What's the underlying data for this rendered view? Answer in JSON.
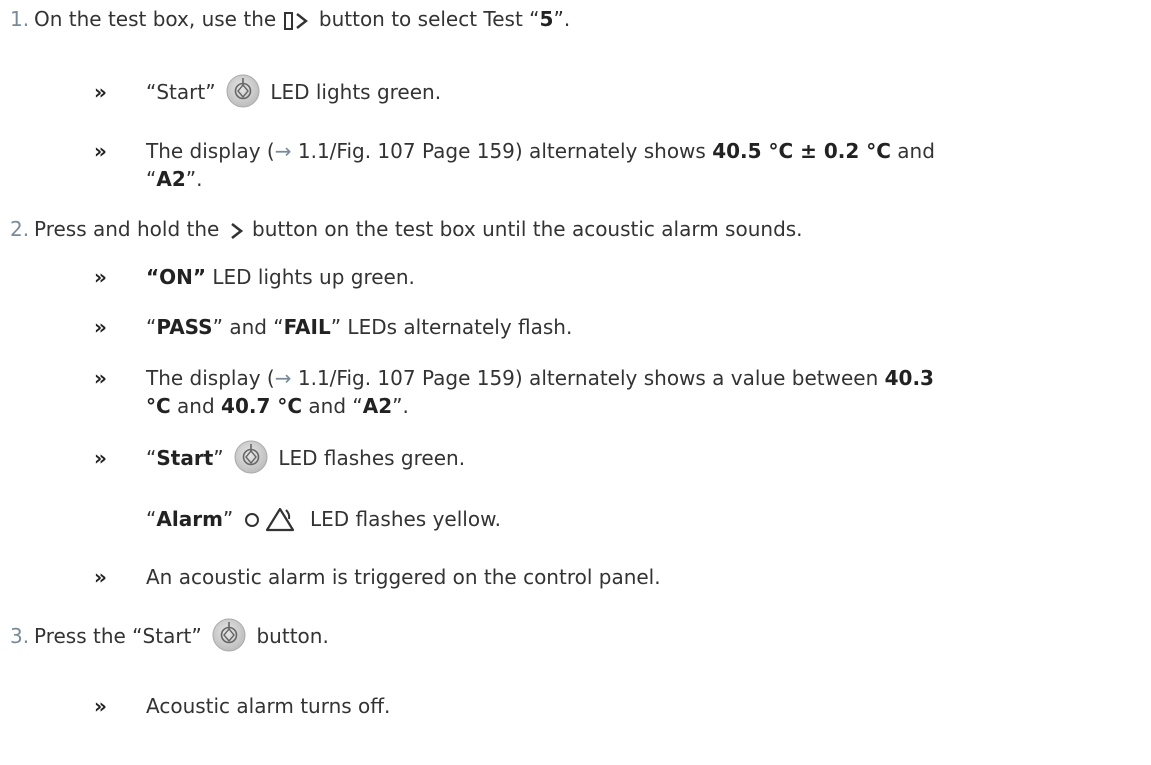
{
  "steps": [
    {
      "number": "1.",
      "text_a": "On the test box, use the",
      "text_b": "button to select Test “",
      "value": "5",
      "text_c": "”.",
      "icon": "bracket-next-icon",
      "results": [
        {
          "pre": "“Start”",
          "post": "LED lights green.",
          "icon": "start-button-icon"
        },
        {
          "line1_pre": "The display (",
          "arrow": "→",
          "ref": " 1.1/Fig. 107 Page 159) alternately shows ",
          "temp": "40.5 °C ± 0.2 °C",
          "and": " and",
          "line2_q1": "“",
          "code": "A2",
          "line2_q2": "”."
        }
      ]
    },
    {
      "number": "2.",
      "text_a": "Press and hold the",
      "text_b": "button on the test box until the acoustic alarm sounds.",
      "icon": "chevron-right-icon",
      "results": [
        {
          "on": "“ON”",
          "text": " LED lights up green."
        },
        {
          "q1": "“",
          "pass": "PASS",
          "mid": "” and “",
          "fail": "FAIL",
          "post": "” LEDs alternately flash."
        },
        {
          "line1_pre": "The display (",
          "arrow": "→",
          "ref": " 1.1/Fig. 107 Page 159) alternately shows a value between ",
          "val1": "40.3",
          "line2_unit": "°C",
          "line2_and": " and ",
          "val2": "40.7 °C",
          "line2_and2": " and “",
          "code": "A2",
          "line2_end": "”."
        },
        {
          "q1": "“",
          "start": "Start",
          "q2": "”",
          "post": "LED flashes green.",
          "alarm_q1": "“",
          "alarm": "Alarm",
          "alarm_q2": "”",
          "alarm_post": "LED flashes yellow."
        },
        {
          "text": "An acoustic alarm is triggered on the control panel."
        }
      ]
    },
    {
      "number": "3.",
      "text_a": "Press the “Start”",
      "text_b": "button.",
      "icon": "start-button-icon",
      "results": [
        {
          "text": "Acoustic alarm turns off."
        }
      ]
    }
  ],
  "bullet_glyph": "»"
}
